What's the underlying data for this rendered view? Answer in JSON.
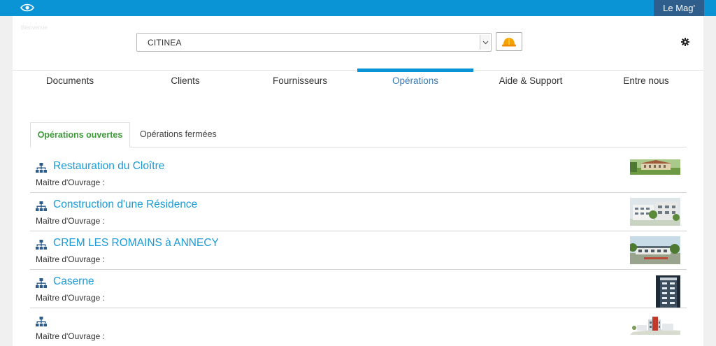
{
  "topbar": {
    "brand_link": "Le Mag'",
    "accent": "#0a94d6",
    "icon": "eye-icon"
  },
  "faint_text": "Bienvenue",
  "header": {
    "project_select_value": "CITINEA",
    "hat_icon": "hard-hat-icon",
    "settings_icon": "gear-icon"
  },
  "nav": {
    "items": [
      "Documents",
      "Clients",
      "Fournisseurs",
      "Opérations",
      "Aide & Support",
      "Entre nous"
    ],
    "active_index": 3
  },
  "tabs": {
    "open": "Opérations ouvertes",
    "closed": "Opérations fermées"
  },
  "operations": [
    {
      "title": "Restauration du Cloître",
      "owner_label": "Maître d'Ouvrage :",
      "icon": "org-chart-icon"
    },
    {
      "title": "Construction d'une Résidence",
      "owner_label": "Maître d'Ouvrage :",
      "icon": "org-chart-icon"
    },
    {
      "title": "CREM LES ROMAINS à ANNECY",
      "owner_label": "Maître d'Ouvrage :",
      "icon": "org-chart-icon"
    },
    {
      "title": "Caserne",
      "owner_label": "Maître d'Ouvrage :",
      "icon": "org-chart-icon"
    },
    {
      "title": "",
      "owner_label": "Maître d'Ouvrage :",
      "icon": "org-chart-icon"
    }
  ]
}
